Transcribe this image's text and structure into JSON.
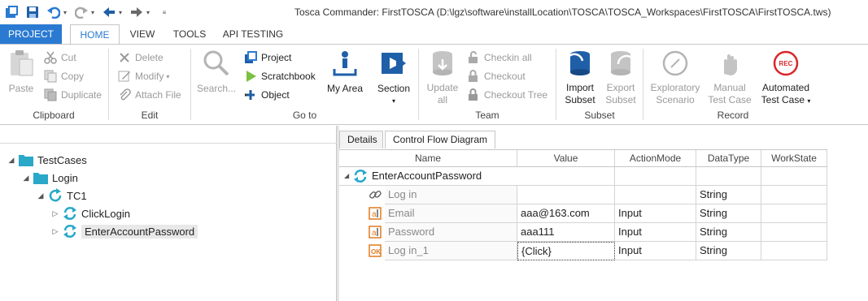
{
  "window": {
    "title": "Tosca Commander: FirstTOSCA (D:\\lgz\\software\\installLocation\\TOSCA\\TOSCA_Workspaces\\FirstTOSCA\\FirstTOSCA.tws)"
  },
  "quick_access": {
    "icons": [
      "app-icon",
      "save-icon",
      "undo-icon",
      "redo-icon",
      "back-icon",
      "forward-icon",
      "customize-icon"
    ]
  },
  "ribbon_tabs": [
    {
      "label": "PROJECT"
    },
    {
      "label": "HOME"
    },
    {
      "label": "VIEW"
    },
    {
      "label": "TOOLS"
    },
    {
      "label": "API TESTING"
    }
  ],
  "ribbon": {
    "clipboard": {
      "label": "Clipboard",
      "paste": "Paste",
      "cut": "Cut",
      "copy": "Copy",
      "duplicate": "Duplicate"
    },
    "edit": {
      "label": "Edit",
      "delete": "Delete",
      "modify": "Modify",
      "attach_file": "Attach File"
    },
    "goto": {
      "label": "Go to",
      "search": "Search...",
      "project": "Project",
      "scratchbook": "Scratchbook",
      "object": "Object",
      "my_area": "My Area",
      "section": "Section"
    },
    "team": {
      "label": "Team",
      "update_all_1": "Update",
      "update_all_2": "all",
      "checkin_all": "Checkin all",
      "checkout": "Checkout",
      "checkout_tree": "Checkout Tree"
    },
    "subset": {
      "label": "Subset",
      "import_1": "Import",
      "import_2": "Subset",
      "export_1": "Export",
      "export_2": "Subset"
    },
    "record": {
      "label": "Record",
      "exploratory_1": "Exploratory",
      "exploratory_2": "Scenario",
      "manual_1": "Manual",
      "manual_2": "Test Case",
      "automated_1": "Automated",
      "automated_2": "Test Case",
      "rec_badge": "REC"
    }
  },
  "tree": {
    "items": [
      {
        "label": "TestCases"
      },
      {
        "label": "Login"
      },
      {
        "label": "TC1"
      },
      {
        "label": "ClickLogin"
      },
      {
        "label": "EnterAccountPassword"
      }
    ]
  },
  "details": {
    "tabs": [
      {
        "label": "Details"
      },
      {
        "label": "Control Flow Diagram"
      }
    ],
    "columns": [
      "Name",
      "Value",
      "ActionMode",
      "DataType",
      "WorkState"
    ],
    "root_row": {
      "name": "EnterAccountPassword"
    },
    "rows": [
      {
        "name": "Log in",
        "value": "",
        "action_mode": "",
        "data_type": "String",
        "work_state": ""
      },
      {
        "name": "Email",
        "value": "aaa@163.com",
        "action_mode": "Input",
        "data_type": "String",
        "work_state": ""
      },
      {
        "name": "Password",
        "value": "aaa111",
        "action_mode": "Input",
        "data_type": "String",
        "work_state": ""
      },
      {
        "name": "Log in_1",
        "value": "{Click}",
        "action_mode": "Input",
        "data_type": "String",
        "work_state": ""
      }
    ]
  },
  "colors": {
    "accent": "#2a7ad2",
    "folder": "#29a8c8",
    "rec": "#d9262b"
  }
}
